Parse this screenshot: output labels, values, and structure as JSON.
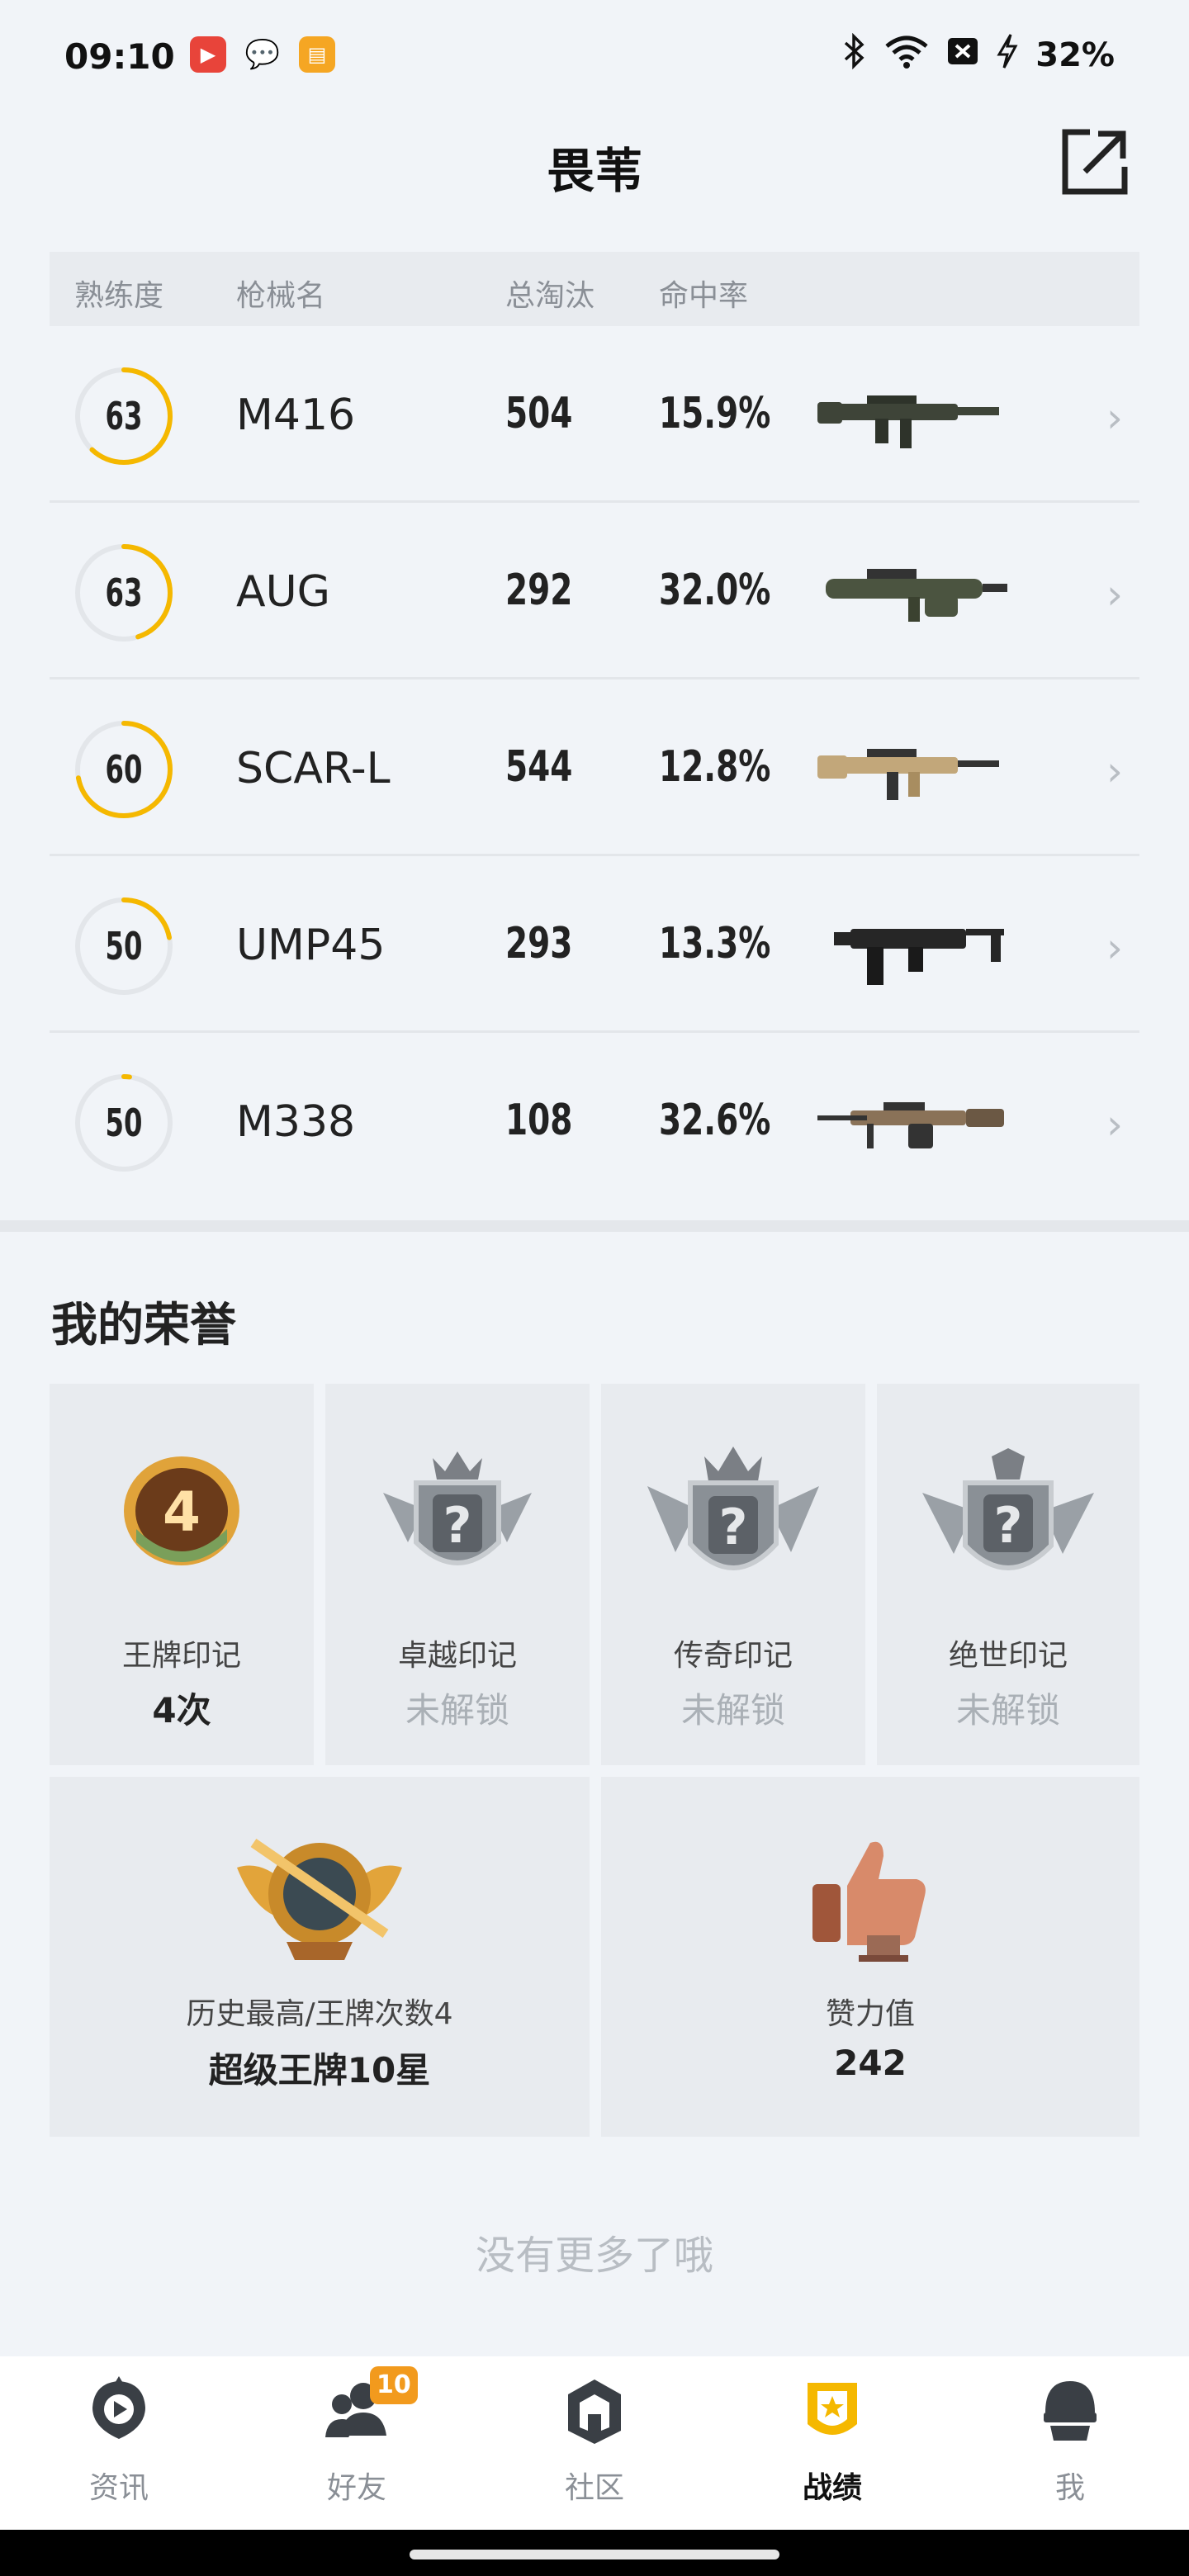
{
  "status_bar": {
    "time": "09:10",
    "battery": "32%",
    "icons": [
      "video-app-icon",
      "wechat-icon",
      "reader-app-icon",
      "bluetooth-icon",
      "wifi-icon",
      "sim-off-icon",
      "charging-icon"
    ]
  },
  "header": {
    "title": "畏苇",
    "share_icon": "external-share-icon"
  },
  "table": {
    "headers": [
      "熟练度",
      "枪械名",
      "总淘汰",
      "命中率"
    ],
    "accent_color": "#f5b800",
    "rows": [
      {
        "proficiency": "63",
        "progress": 0.62,
        "name": "M416",
        "kills": "504",
        "accuracy": "15.9%",
        "gun": "m416"
      },
      {
        "proficiency": "63",
        "progress": 0.45,
        "name": "AUG",
        "kills": "292",
        "accuracy": "32.0%",
        "gun": "aug"
      },
      {
        "proficiency": "60",
        "progress": 0.72,
        "name": "SCAR-L",
        "kills": "544",
        "accuracy": "12.8%",
        "gun": "scar"
      },
      {
        "proficiency": "50",
        "progress": 0.22,
        "name": "UMP45",
        "kills": "293",
        "accuracy": "13.3%",
        "gun": "ump"
      },
      {
        "proficiency": "50",
        "progress": 0.02,
        "name": "M338",
        "kills": "108",
        "accuracy": "32.6%",
        "gun": "m338"
      }
    ]
  },
  "honors": {
    "title": "我的荣誉",
    "badges": [
      {
        "label": "王牌印记",
        "value": "4次",
        "locked": false,
        "badge_text": "4"
      },
      {
        "label": "卓越印记",
        "value": "未解锁",
        "locked": true,
        "badge_text": "?"
      },
      {
        "label": "传奇印记",
        "value": "未解锁",
        "locked": true,
        "badge_text": "?"
      },
      {
        "label": "绝世印记",
        "value": "未解锁",
        "locked": true,
        "badge_text": "?"
      }
    ],
    "highest": {
      "label": "历史最高/王牌次数4",
      "value": "超级王牌10星"
    },
    "likes": {
      "label": "赞力值",
      "value": "242"
    }
  },
  "footer_text": "没有更多了哦",
  "nav": {
    "items": [
      {
        "label": "资讯",
        "icon": "news-icon",
        "active": false
      },
      {
        "label": "好友",
        "icon": "friends-icon",
        "active": false,
        "badge": "10"
      },
      {
        "label": "社区",
        "icon": "community-icon",
        "active": false
      },
      {
        "label": "战绩",
        "icon": "record-icon",
        "active": true
      },
      {
        "label": "我",
        "icon": "profile-icon",
        "active": false
      }
    ]
  }
}
